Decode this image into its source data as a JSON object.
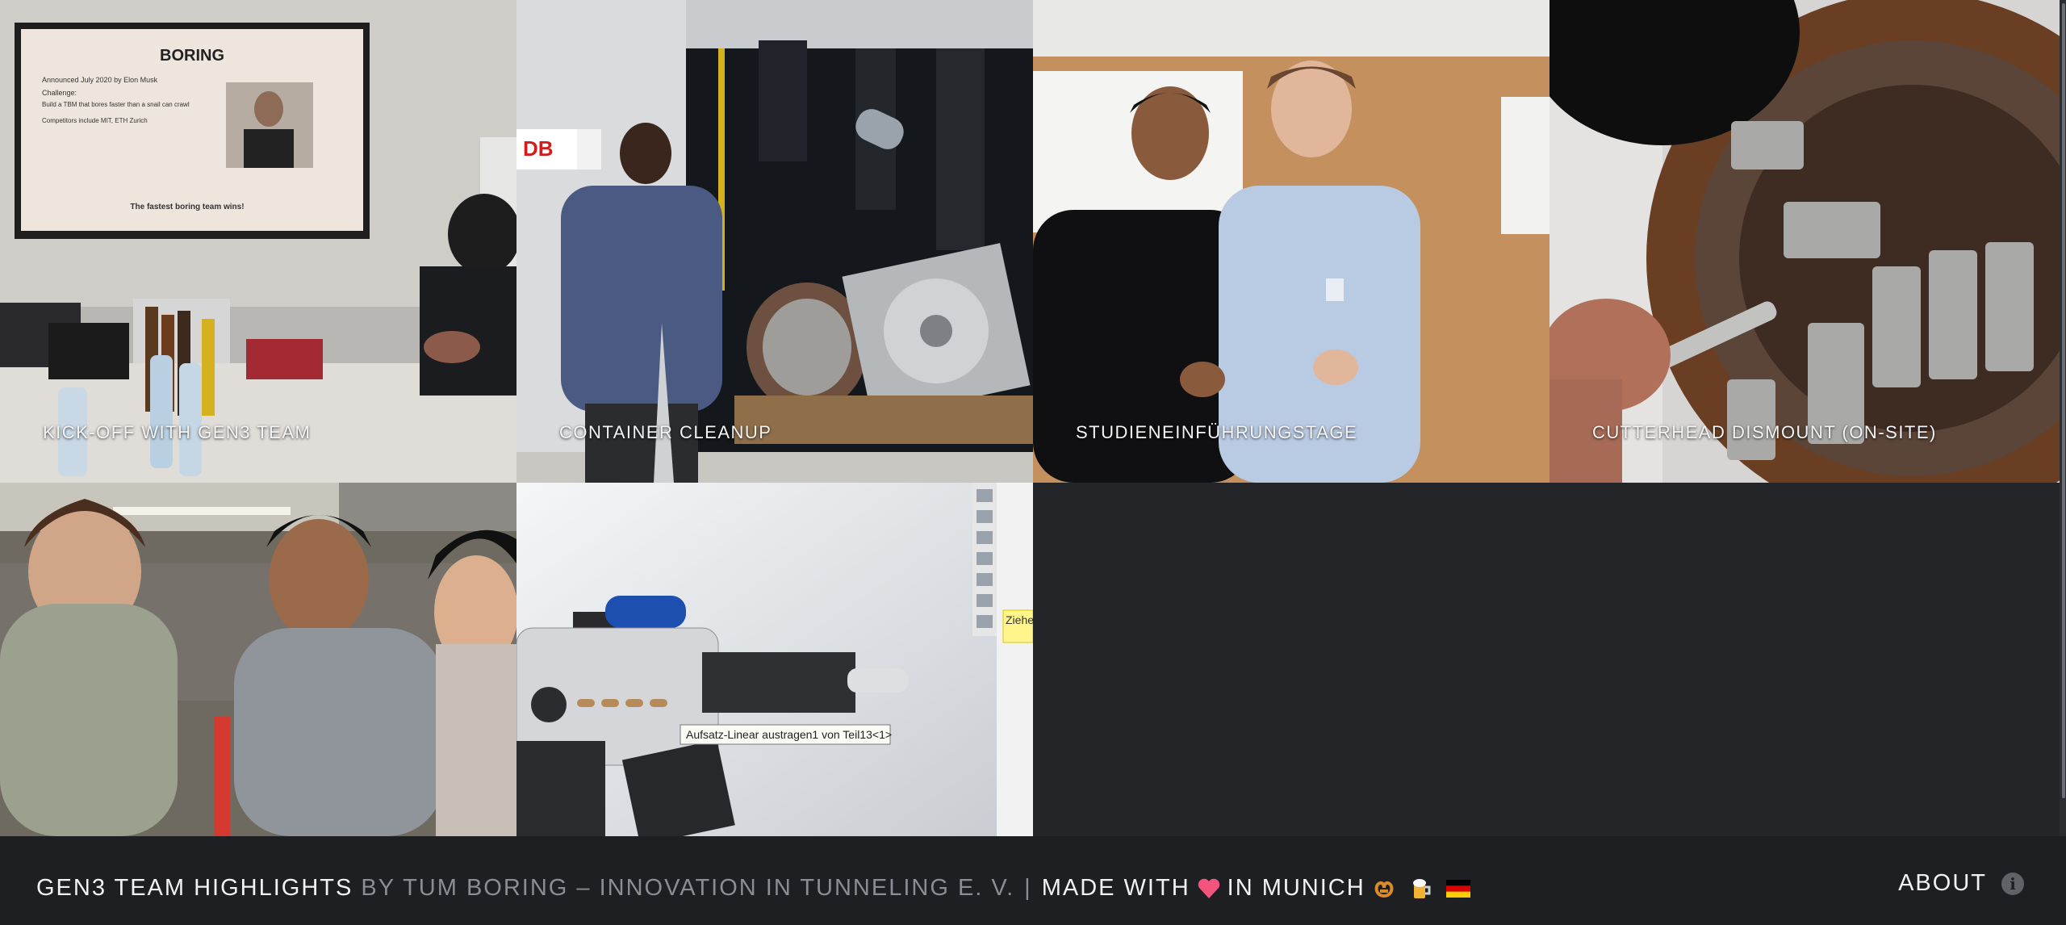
{
  "tiles": [
    {
      "caption": "Kick-off with Gen3 Team"
    },
    {
      "caption": "Container Cleanup"
    },
    {
      "caption": "Studieneinführungstage"
    },
    {
      "caption": "Cutterhead Dismount (on-site)"
    },
    {
      "caption": ""
    },
    {
      "caption": ""
    }
  ],
  "slide": {
    "heading": "BORING",
    "bullets": [
      "Announced July 2020 by Elon Musk",
      "Challenge:",
      "Build a TBM that bores faster than a snail can crawl",
      "Competitors include MIT, ETH Zurich"
    ],
    "footer": "The fastest boring team wins!"
  },
  "cad": {
    "tooltip": "Aufsatz-Linear austragen1 von Teil13<1>",
    "side_label": "Ziehe"
  },
  "footer": {
    "title": "GEN3 TEAM HIGHLIGHTS",
    "org": "BY TUM BORING – INNOVATION IN TUNNELING E. V.",
    "separator": "|",
    "made_with": "MADE WITH",
    "in_munich": "IN MUNICH",
    "about": "ABOUT",
    "icons": [
      "heart-icon",
      "pretzel-icon",
      "beer-icon",
      "germany-flag-icon",
      "info-icon"
    ]
  },
  "colors": {
    "background": "#232529",
    "footer": "#1d1f22",
    "caption": "#f4f4f4",
    "muted": "#8a8d93"
  }
}
